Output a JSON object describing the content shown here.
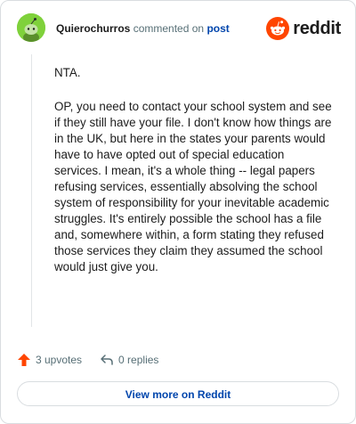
{
  "header": {
    "username": "Quierochurros",
    "action": "commented on",
    "link_text": "post",
    "brand": "reddit",
    "avatar_icon": "snoo-avatar-icon",
    "brand_icon": "reddit-snoo-logo-icon"
  },
  "comment": {
    "paragraphs": [
      "NTA.",
      "OP, you need to contact your school system and see if they still have your file. I don't know how things are in the UK, but here in the states your parents would have to have opted out of special education services. I mean, it's a whole thing -- legal papers refusing services, essentially absolving the school system of responsibility for your inevitable academic struggles. It's entirely possible the school has a file and, somewhere within, a form stating they refused those services they claim they assumed the school would just give you."
    ]
  },
  "actions": {
    "upvotes": "3 upvotes",
    "replies": "0 replies",
    "upvote_icon": "upvote-arrow-icon",
    "reply_icon": "reply-arrow-icon"
  },
  "footer": {
    "view_more": "View more on Reddit"
  },
  "colors": {
    "brand_orange": "#ff4500",
    "link_blue": "#0045ac",
    "avatar_green": "#7fd13b",
    "muted_text": "#576f76"
  }
}
